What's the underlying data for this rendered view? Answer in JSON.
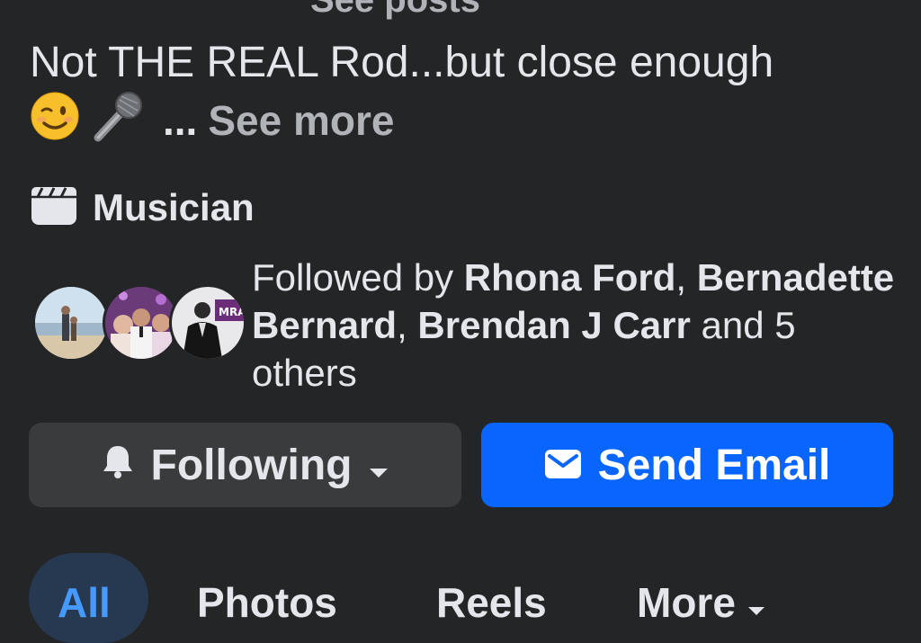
{
  "profile": {
    "clipped_header": "See posts",
    "bio_line1": "Not THE REAL Rod...but close enough",
    "bio_emojis": [
      "winking-face-emoji",
      "microphone-emoji"
    ],
    "bio_ellipsis": "...",
    "see_more": "See more",
    "category": "Musician",
    "followed": {
      "prefix": "Followed by ",
      "name1": "Rhona Ford",
      "sep1": ",",
      "name2": "Bernadette Bernard",
      "sep2": ", ",
      "name3": "Brendan J Carr",
      "suffix": " and 5 others"
    }
  },
  "actions": {
    "following_label": "Following",
    "send_email_label": "Send Email"
  },
  "tabs": [
    {
      "label": "All",
      "active": true
    },
    {
      "label": "Photos",
      "active": false
    },
    {
      "label": "Reels",
      "active": false
    },
    {
      "label": "More",
      "active": false
    }
  ],
  "colors": {
    "background": "#242526",
    "primary_button": "#0866ff",
    "secondary_button": "#3a3b3c",
    "active_tab_bg": "#263951",
    "active_tab_text": "#4599ff"
  }
}
